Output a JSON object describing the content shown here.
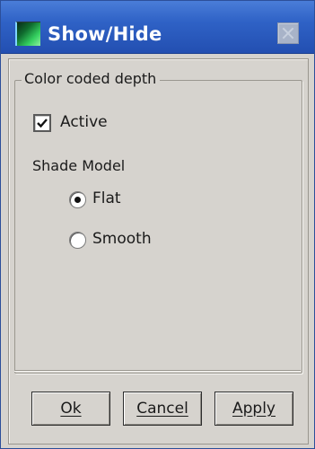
{
  "window": {
    "title": "Show/Hide",
    "app_icon": "depth-map-icon",
    "close_icon": "close-icon"
  },
  "group": {
    "label": "Color coded depth",
    "active_checkbox": {
      "label": "Active",
      "checked": true
    },
    "shade_model": {
      "label": "Shade Model",
      "options": [
        {
          "label": "Flat",
          "selected": true
        },
        {
          "label": "Smooth",
          "selected": false
        }
      ]
    }
  },
  "buttons": {
    "ok": "Ok",
    "cancel": "Cancel",
    "apply": "Apply"
  },
  "colors": {
    "titlebar": "#2f62c6",
    "dialog_bg": "#d6d3ce"
  }
}
